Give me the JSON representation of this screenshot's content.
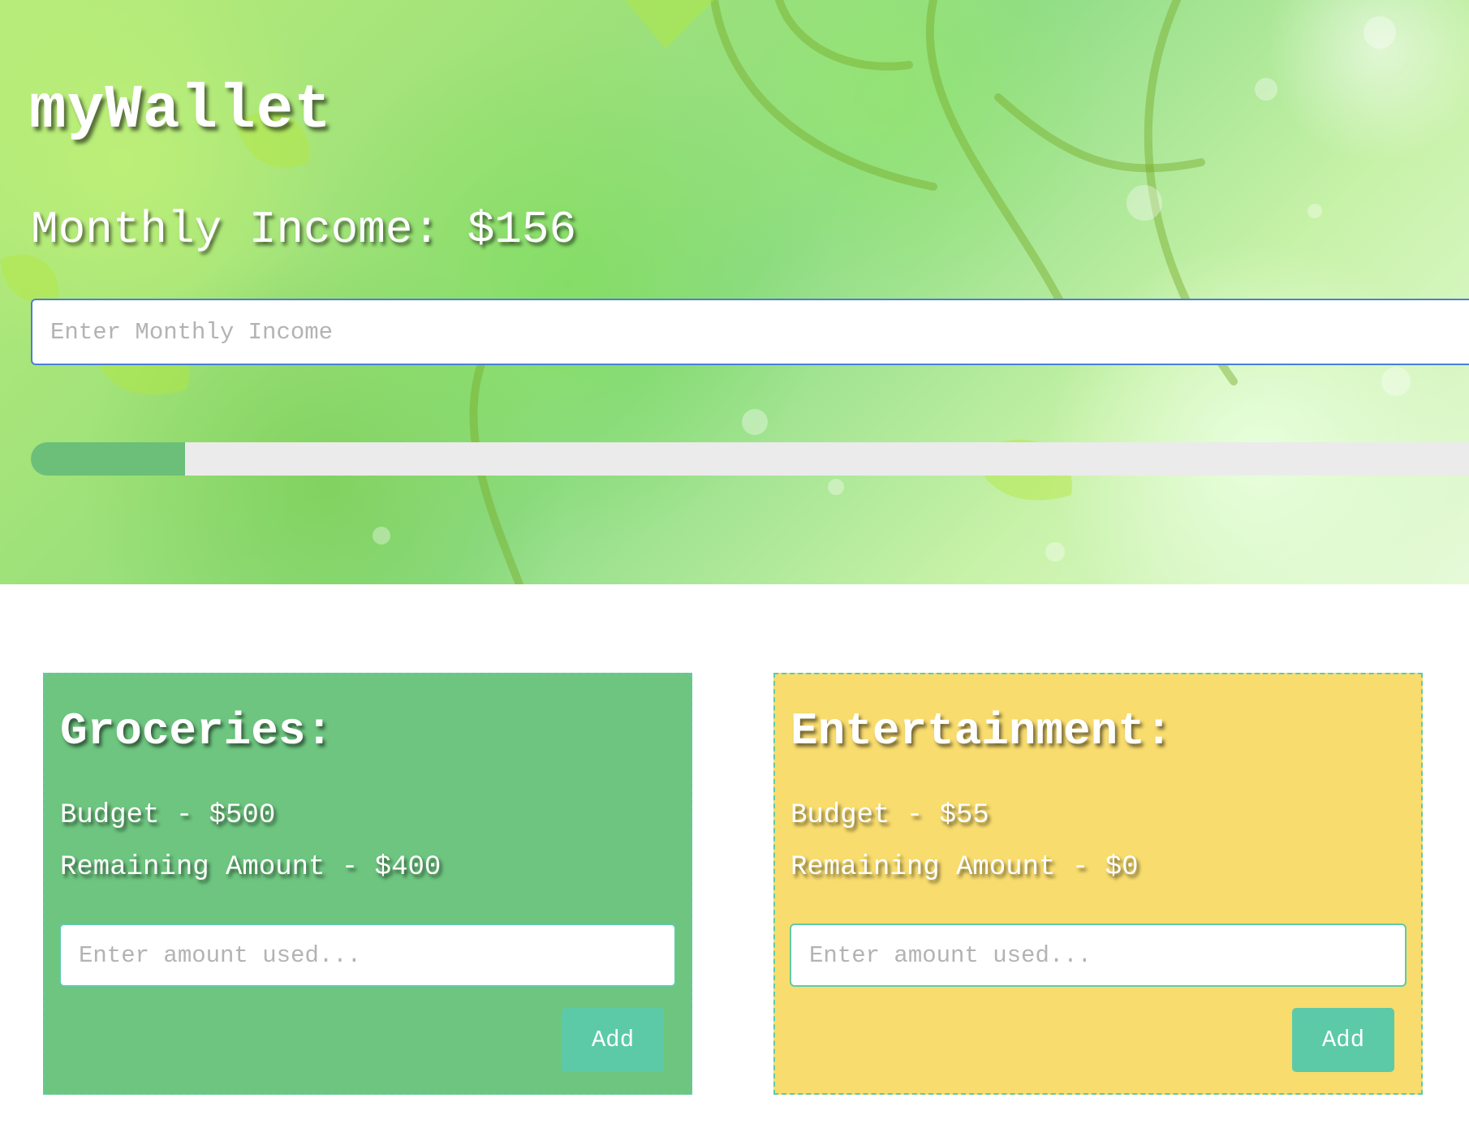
{
  "app": {
    "title": "myWallet"
  },
  "income": {
    "label": "Monthly Income: $156",
    "input_placeholder": "Enter Monthly Income",
    "input_value": ""
  },
  "progress": {
    "fraction": 0.105,
    "fill_color": "#6bbf79",
    "track_color": "#ebebeb"
  },
  "categories": [
    {
      "title": "Groceries:",
      "budget": "Budget - $500",
      "remaining": "Remaining Amount - $400",
      "input_placeholder": "Enter amount used...",
      "button_label": "Add",
      "background": "#6dc57f"
    },
    {
      "title": "Entertainment:",
      "budget": "Budget - $55",
      "remaining": "Remaining Amount - $0",
      "input_placeholder": "Enter amount used...",
      "button_label": "Add",
      "background": "#f8dc6e"
    }
  ],
  "colors": {
    "accent": "#5ccaa7",
    "focus_border": "#4a7fd8"
  }
}
